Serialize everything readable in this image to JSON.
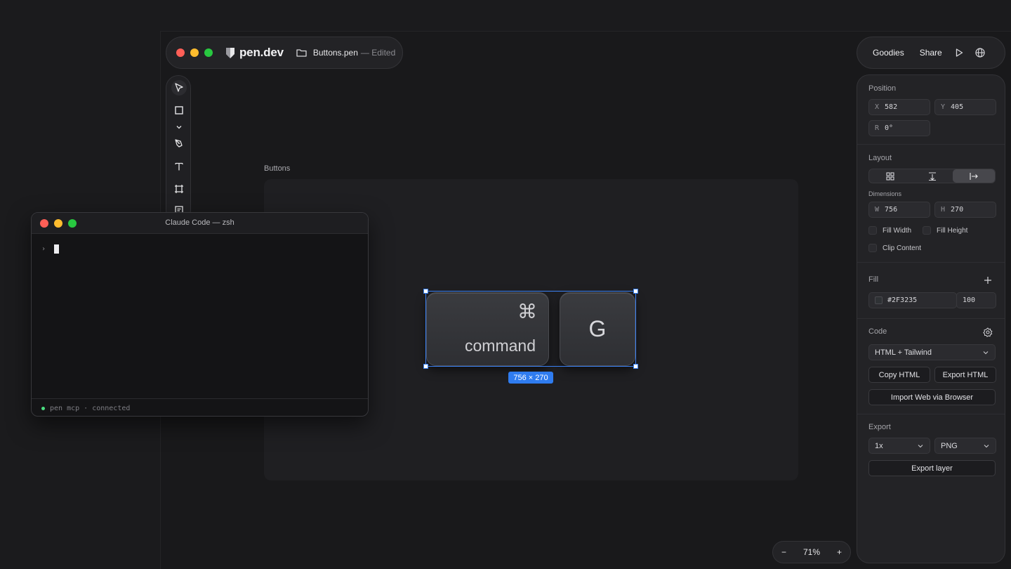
{
  "app": {
    "brand": "pen.dev",
    "file_name": "Buttons.pen",
    "file_status": "— Edited"
  },
  "toolbar_right": {
    "goodies": "Goodies",
    "share": "Share",
    "icons": [
      "play-icon",
      "globe-icon"
    ]
  },
  "tools": [
    "pointer-icon",
    "rectangle-icon",
    "chevron-down-icon",
    "pen-tool-icon",
    "text-icon",
    "frame-icon",
    "note-icon"
  ],
  "canvas": {
    "frame_label": "Buttons",
    "key_command_symbol": "⌘",
    "key_command_word": "command",
    "key_g": "G",
    "dimensions_badge": "756 × 270"
  },
  "terminal": {
    "title": "Claude Code — zsh",
    "prompt": "›",
    "status": "pen mcp · connected"
  },
  "panel": {
    "position": {
      "label": "Position",
      "x_prefix": "X",
      "x_value": "582",
      "y_prefix": "Y",
      "y_value": "405",
      "r_prefix": "R",
      "r_value": "0°"
    },
    "layout": {
      "label": "Layout",
      "dimensions_label": "Dimensions",
      "w_prefix": "W",
      "w_value": "756",
      "h_prefix": "H",
      "h_value": "270",
      "fill_width": "Fill Width",
      "fill_height": "Fill Height",
      "clip_content": "Clip Content"
    },
    "fill": {
      "label": "Fill",
      "color": "#2F3235",
      "opacity": "100"
    },
    "code": {
      "label": "Code",
      "framework": "HTML + Tailwind",
      "copy_html": "Copy HTML",
      "export_html": "Export HTML",
      "import_web": "Import Web via Browser"
    },
    "export": {
      "label": "Export",
      "scale": "1x",
      "format": "PNG",
      "export_layer": "Export layer"
    }
  },
  "zoom": {
    "minus": "−",
    "value": "71%",
    "plus": "+"
  }
}
